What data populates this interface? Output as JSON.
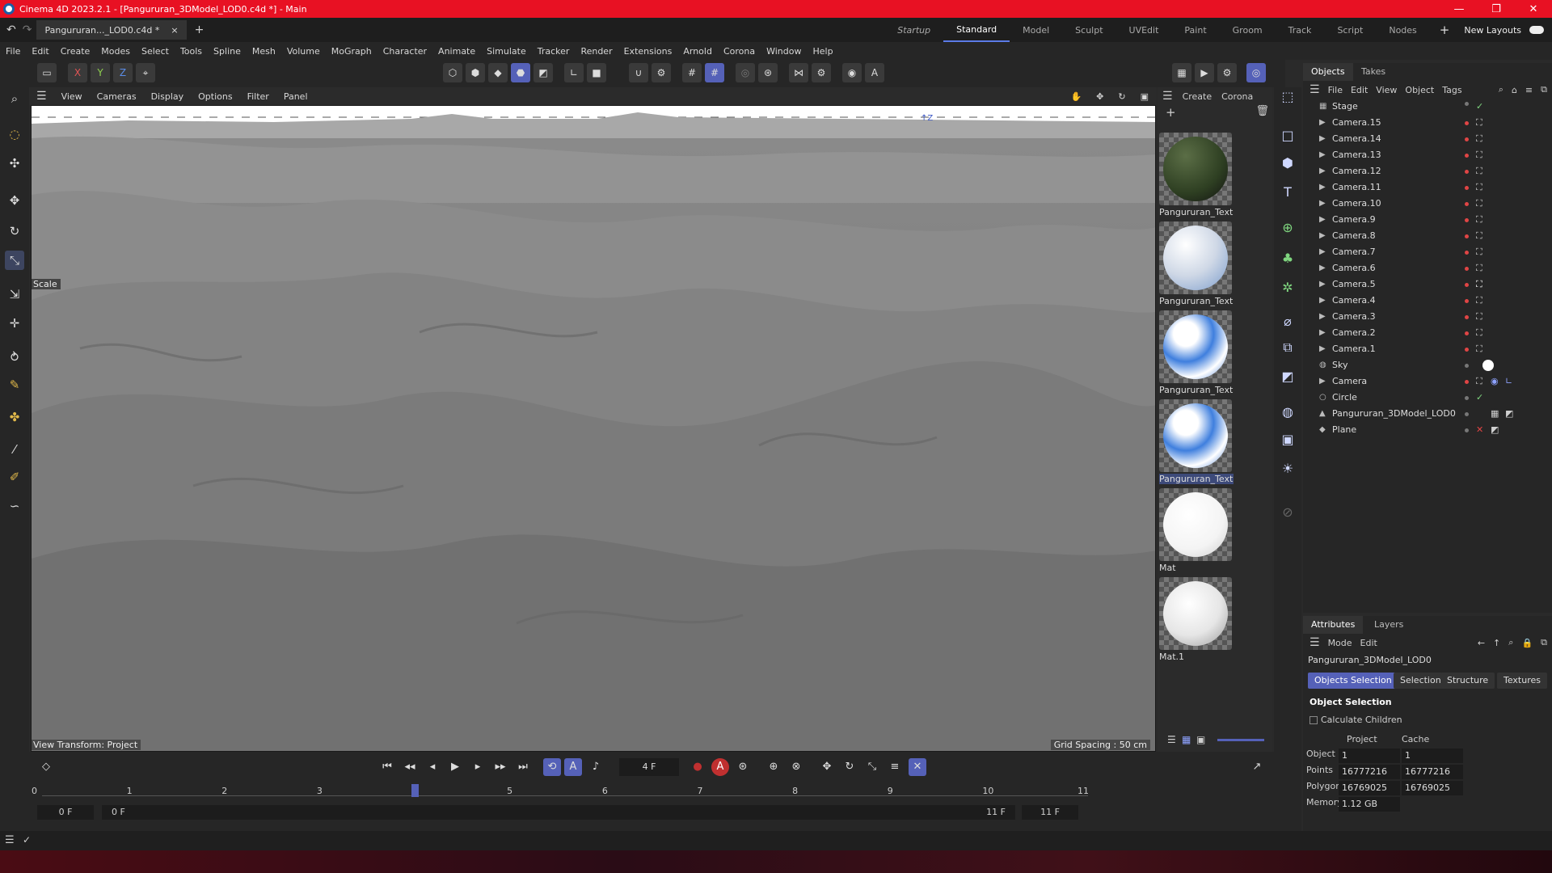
{
  "window": {
    "title": "Cinema 4D 2023.2.1 - [Pangururan_3DModel_LOD0.c4d *] - Main",
    "min": "—",
    "max": "❐",
    "close": "✕"
  },
  "tabs": {
    "doc": "Pangururan..._LOD0.c4d *",
    "doc_close": "×",
    "add": "+",
    "new_layouts": "New Layouts"
  },
  "layouts": [
    "Startup",
    "Standard",
    "Model",
    "Sculpt",
    "UVEdit",
    "Paint",
    "Groom",
    "Track",
    "Script",
    "Nodes"
  ],
  "menu": [
    "File",
    "Edit",
    "Create",
    "Modes",
    "Select",
    "Tools",
    "Spline",
    "Mesh",
    "Volume",
    "MoGraph",
    "Character",
    "Animate",
    "Simulate",
    "Tracker",
    "Render",
    "Extensions",
    "Arnold",
    "Corona",
    "Window",
    "Help"
  ],
  "axis_toggles": [
    "X",
    "Y",
    "Z"
  ],
  "viewport": {
    "menu": [
      "View",
      "Cameras",
      "Display",
      "Options",
      "Filter",
      "Panel"
    ],
    "scale_label": "Scale",
    "view_transform": "View Transform: Project",
    "grid_spacing": "Grid Spacing : 50 cm"
  },
  "materials_panel": {
    "menu": [
      "Create",
      "Corona"
    ],
    "items": [
      {
        "label": "Pangururan_Textu",
        "color": "#2e3f22"
      },
      {
        "label": "Pangururan_Textu",
        "color": "#d8dde6"
      },
      {
        "label": "Pangururan_Textu",
        "color": "#2f6fd0"
      },
      {
        "label": "Pangururan_Textu",
        "color": "#2f6fd0"
      },
      {
        "label": "Mat",
        "color": "#ffffff"
      },
      {
        "label": "Mat.1",
        "color": "#e6e6e6"
      }
    ]
  },
  "objects_panel": {
    "tabs": [
      "Objects",
      "Takes"
    ],
    "menu": [
      "File",
      "Edit",
      "View",
      "Object",
      "Tags"
    ],
    "items": [
      "Stage",
      "Camera.15",
      "Camera.14",
      "Camera.13",
      "Camera.12",
      "Camera.11",
      "Camera.10",
      "Camera.9",
      "Camera.8",
      "Camera.7",
      "Camera.6",
      "Camera.5",
      "Camera.4",
      "Camera.3",
      "Camera.2",
      "Camera.1",
      "Sky",
      "Camera",
      "Circle",
      "Pangururan_3DModel_LOD0",
      "Plane"
    ]
  },
  "attributes": {
    "tabs": [
      "Attributes",
      "Layers"
    ],
    "menu": [
      "Mode",
      "Edit"
    ],
    "object_name": "Pangururan_3DModel_LOD0",
    "subtabs": [
      "Objects Selection",
      "Selection",
      "Structure",
      "Textures"
    ],
    "section": "Object Selection",
    "calc_children": "Calculate Children",
    "col_project": "Project",
    "col_cache": "Cache",
    "rows": [
      {
        "label": "Object",
        "project": "1",
        "cache": "1"
      },
      {
        "label": "Points",
        "project": "16777216",
        "cache": "16777216"
      },
      {
        "label": "Polygons",
        "project": "16769025",
        "cache": "16769025"
      },
      {
        "label": "Memory",
        "project": "1.12 GB",
        "cache": ""
      }
    ]
  },
  "timeline": {
    "current_frame": "4 F",
    "ticks": [
      "0",
      "1",
      "2",
      "3",
      "4",
      "5",
      "6",
      "7",
      "8",
      "9",
      "10",
      "11"
    ],
    "start": "0 F",
    "start2": "0 F",
    "end": "11 F",
    "end2": "11 F",
    "current_frame_value": 4,
    "max_frame": 11
  },
  "colors": {
    "accent": "#5561b8",
    "titlebar": "#e81123"
  }
}
